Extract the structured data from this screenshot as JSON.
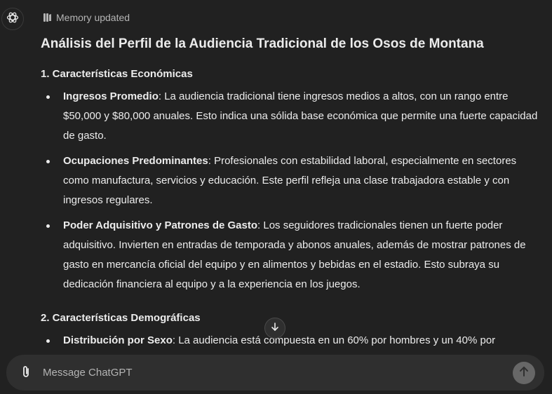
{
  "memory_status": "Memory updated",
  "title": "Análisis del Perfil de la Audiencia Tradicional de los Osos de Montana",
  "sections": [
    {
      "heading": "1. Características Económicas",
      "items": [
        {
          "label": "Ingresos Promedio",
          "text": ": La audiencia tradicional tiene ingresos medios a altos, con un rango entre $50,000 y $80,000 anuales. Esto indica una sólida base económica que permite una fuerte capacidad de gasto."
        },
        {
          "label": "Ocupaciones Predominantes",
          "text": ": Profesionales con estabilidad laboral, especialmente en sectores como manufactura, servicios y educación. Este perfil refleja una clase trabajadora estable y con ingresos regulares."
        },
        {
          "label": "Poder Adquisitivo y Patrones de Gasto",
          "text": ": Los seguidores tradicionales tienen un fuerte poder adquisitivo. Invierten en entradas de temporada y abonos anuales, además de mostrar patrones de gasto en mercancía oficial del equipo y en alimentos y bebidas en el estadio. Esto subraya su dedicación financiera al equipo y a la experiencia en los juegos."
        }
      ]
    },
    {
      "heading": "2. Características Demográficas",
      "items": [
        {
          "label": "Distribución por Sexo",
          "text": ": La audiencia está compuesta en un 60% por hombres y un 40% por"
        }
      ]
    }
  ],
  "composer": {
    "placeholder": "Message ChatGPT",
    "value": ""
  },
  "icons": {
    "avatar": "openai-logo-icon",
    "memory": "memory-icon",
    "scroll": "arrow-down-icon",
    "attach": "paperclip-icon",
    "send": "arrow-up-icon"
  },
  "colors": {
    "background": "#212121",
    "text": "#ececec",
    "muted": "#b4b4b4",
    "composer": "#2f2f2f",
    "send_button": "#676767"
  }
}
